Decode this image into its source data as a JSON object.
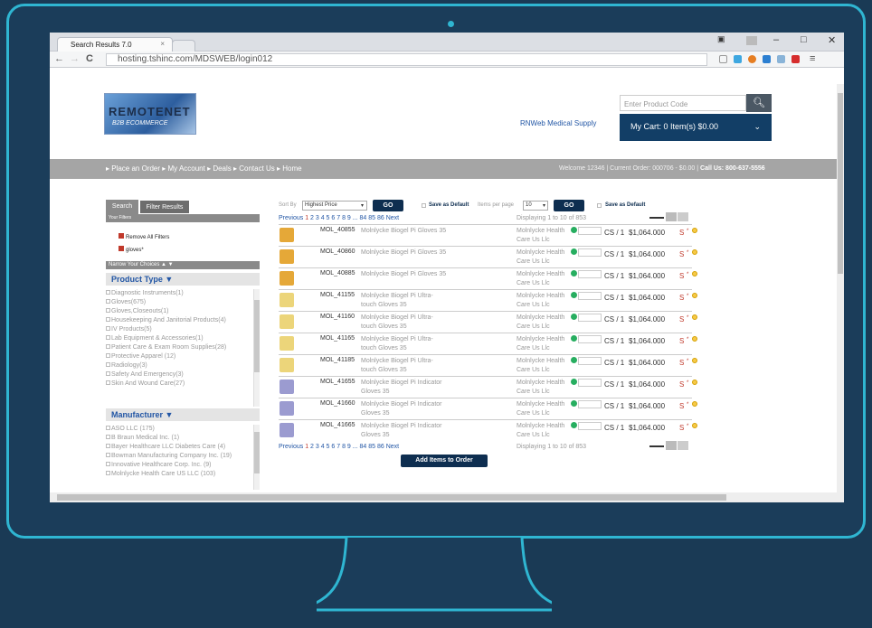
{
  "browser": {
    "tab_title": "Search Results 7.0",
    "tab_close": "×",
    "url": "hosting.tshinc.com/MDSWEB/login012",
    "back": "←",
    "forward": "→",
    "reload": "C",
    "minimize": "–",
    "maximize": "□",
    "close": "✕",
    "menu": "≡"
  },
  "header": {
    "logo_line1": "REMOTENET",
    "logo_line2": "B2B ECOMMERCE",
    "supply_link": "RNWeb Medical Supply",
    "product_code_placeholder": "Enter Product Code",
    "cart_label": "My Cart:  0 Item(s) $0.00"
  },
  "navbar": {
    "links": "▸ Place an Order ▸ My Account ▸ Deals ▸ Contact Us ▸ Home",
    "welcome": "Welcome 12346 | Current Order: 000706 - $0.00 | ",
    "call": "Call Us: 800-637-5556"
  },
  "sidebar": {
    "tab_search": "Search",
    "tab_filter": "Filter Results",
    "your_filters": "Your Filters",
    "remove_all": "Remove All Filters",
    "filter_gloves": "gloves*",
    "narrow": "Narrow Your Choices ▲ ▼",
    "product_type_head": "Product Type ▼",
    "product_types": [
      "Diagnostic Instruments(1)",
      "Gloves(675)",
      "Gloves,Closeouts(1)",
      "Housekeeping And Janitorial Products(4)",
      "IV Products(5)",
      "Lab Equipment & Accessories(1)",
      "Patient Care & Exam Room Supplies(28)",
      "Protective Apparel (12)",
      "Radiology(3)",
      "Safety And Emergency(3)",
      "Skin And Wound Care(27)"
    ],
    "manufacturer_head": "Manufacturer ▼",
    "manufacturers": [
      "ASO LLC (175)",
      "B Braun Medical Inc. (1)",
      "Bayer Healthcare LLC Diabetes Care (4)",
      "Bowman Manufacturing Company Inc. (19)",
      "Innovative Healthcare Corp. Inc. (9)",
      "Molnlycke Health Care US LLC (103)"
    ]
  },
  "main": {
    "sort_by": "Sort By",
    "sort_value": "Highest Price",
    "go": "GO",
    "save_default": "Save as Default",
    "items_per_page": "Items per page",
    "per_page_value": "10",
    "pager": {
      "previous": "Previous",
      "current": "1",
      "pages": "2 3 4 5 6 7 8 9 ... 84 85 86",
      "next": "Next",
      "displaying": "Displaying 1 to 10 of 853"
    },
    "add_items": "Add Items to Order",
    "rows": [
      {
        "code": "MOL_40855",
        "desc": "Molnlycke Biogel Pi Gloves 35",
        "mfr": "Molnlycke Health Care Us Llc",
        "uom": "CS / 1",
        "price": "$1,064.000",
        "s": "S",
        "star": "*"
      },
      {
        "code": "MOL_40860",
        "desc": "Molnlycke Biogel Pi Gloves 35",
        "mfr": "Molnlycke Health Care Us Llc",
        "uom": "CS / 1",
        "price": "$1,064.000",
        "s": "S",
        "star": "*"
      },
      {
        "code": "MOL_40885",
        "desc": "Molnlycke Biogel Pi Gloves 35",
        "mfr": "Molnlycke Health Care Us Llc",
        "uom": "CS / 1",
        "price": "$1,064.000",
        "s": "S",
        "star": "*"
      },
      {
        "code": "MOL_41155",
        "desc": "Molnlycke Biogel Pi Ultra-touch Gloves 35",
        "mfr": "Molnlycke Health Care Us Llc",
        "uom": "CS / 1",
        "price": "$1,064.000",
        "s": "S",
        "star": "*"
      },
      {
        "code": "MOL_41160",
        "desc": "Molnlycke Biogel Pi Ultra-touch Gloves 35",
        "mfr": "Molnlycke Health Care Us Llc",
        "uom": "CS / 1",
        "price": "$1,064.000",
        "s": "S",
        "star": "*"
      },
      {
        "code": "MOL_41165",
        "desc": "Molnlycke Biogel Pi Ultra-touch Gloves 35",
        "mfr": "Molnlycke Health Care Us Llc",
        "uom": "CS / 1",
        "price": "$1,064.000",
        "s": "S",
        "star": "*"
      },
      {
        "code": "MOL_41185",
        "desc": "Molnlycke Biogel Pi Ultra-touch Gloves 35",
        "mfr": "Molnlycke Health Care Us Llc",
        "uom": "CS / 1",
        "price": "$1,064.000",
        "s": "S",
        "star": "*"
      },
      {
        "code": "MOL_41655",
        "desc": "Molnlycke Biogel Pi Indicator Gloves 35",
        "mfr": "Molnlycke Health Care Us Llc",
        "uom": "CS / 1",
        "price": "$1,064.000",
        "s": "S",
        "star": "*"
      },
      {
        "code": "MOL_41660",
        "desc": "Molnlycke Biogel Pi Indicator Gloves 35",
        "mfr": "Molnlycke Health Care Us Llc",
        "uom": "CS / 1",
        "price": "$1,064.000",
        "s": "S",
        "star": "*"
      },
      {
        "code": "MOL_41665",
        "desc": "Molnlycke Biogel Pi Indicator Gloves 35",
        "mfr": "Molnlycke Health Care Us Llc",
        "uom": "CS / 1",
        "price": "$1,064.000",
        "s": "S",
        "star": "*"
      }
    ]
  },
  "colors": {
    "frame": "#2fb6d2",
    "cart_bg": "#123e66",
    "go_bg": "#0e2e50",
    "accent_red": "#c0392b",
    "link_blue": "#2256a5",
    "box_orange": "#e5a838",
    "box_yellow": "#ecd57a",
    "box_purple": "#9b9bd0"
  },
  "icons": [
    "search-icon",
    "chevron-down-icon",
    "star-icon",
    "grid-view-icon",
    "list-view-icon",
    "info-icon"
  ]
}
